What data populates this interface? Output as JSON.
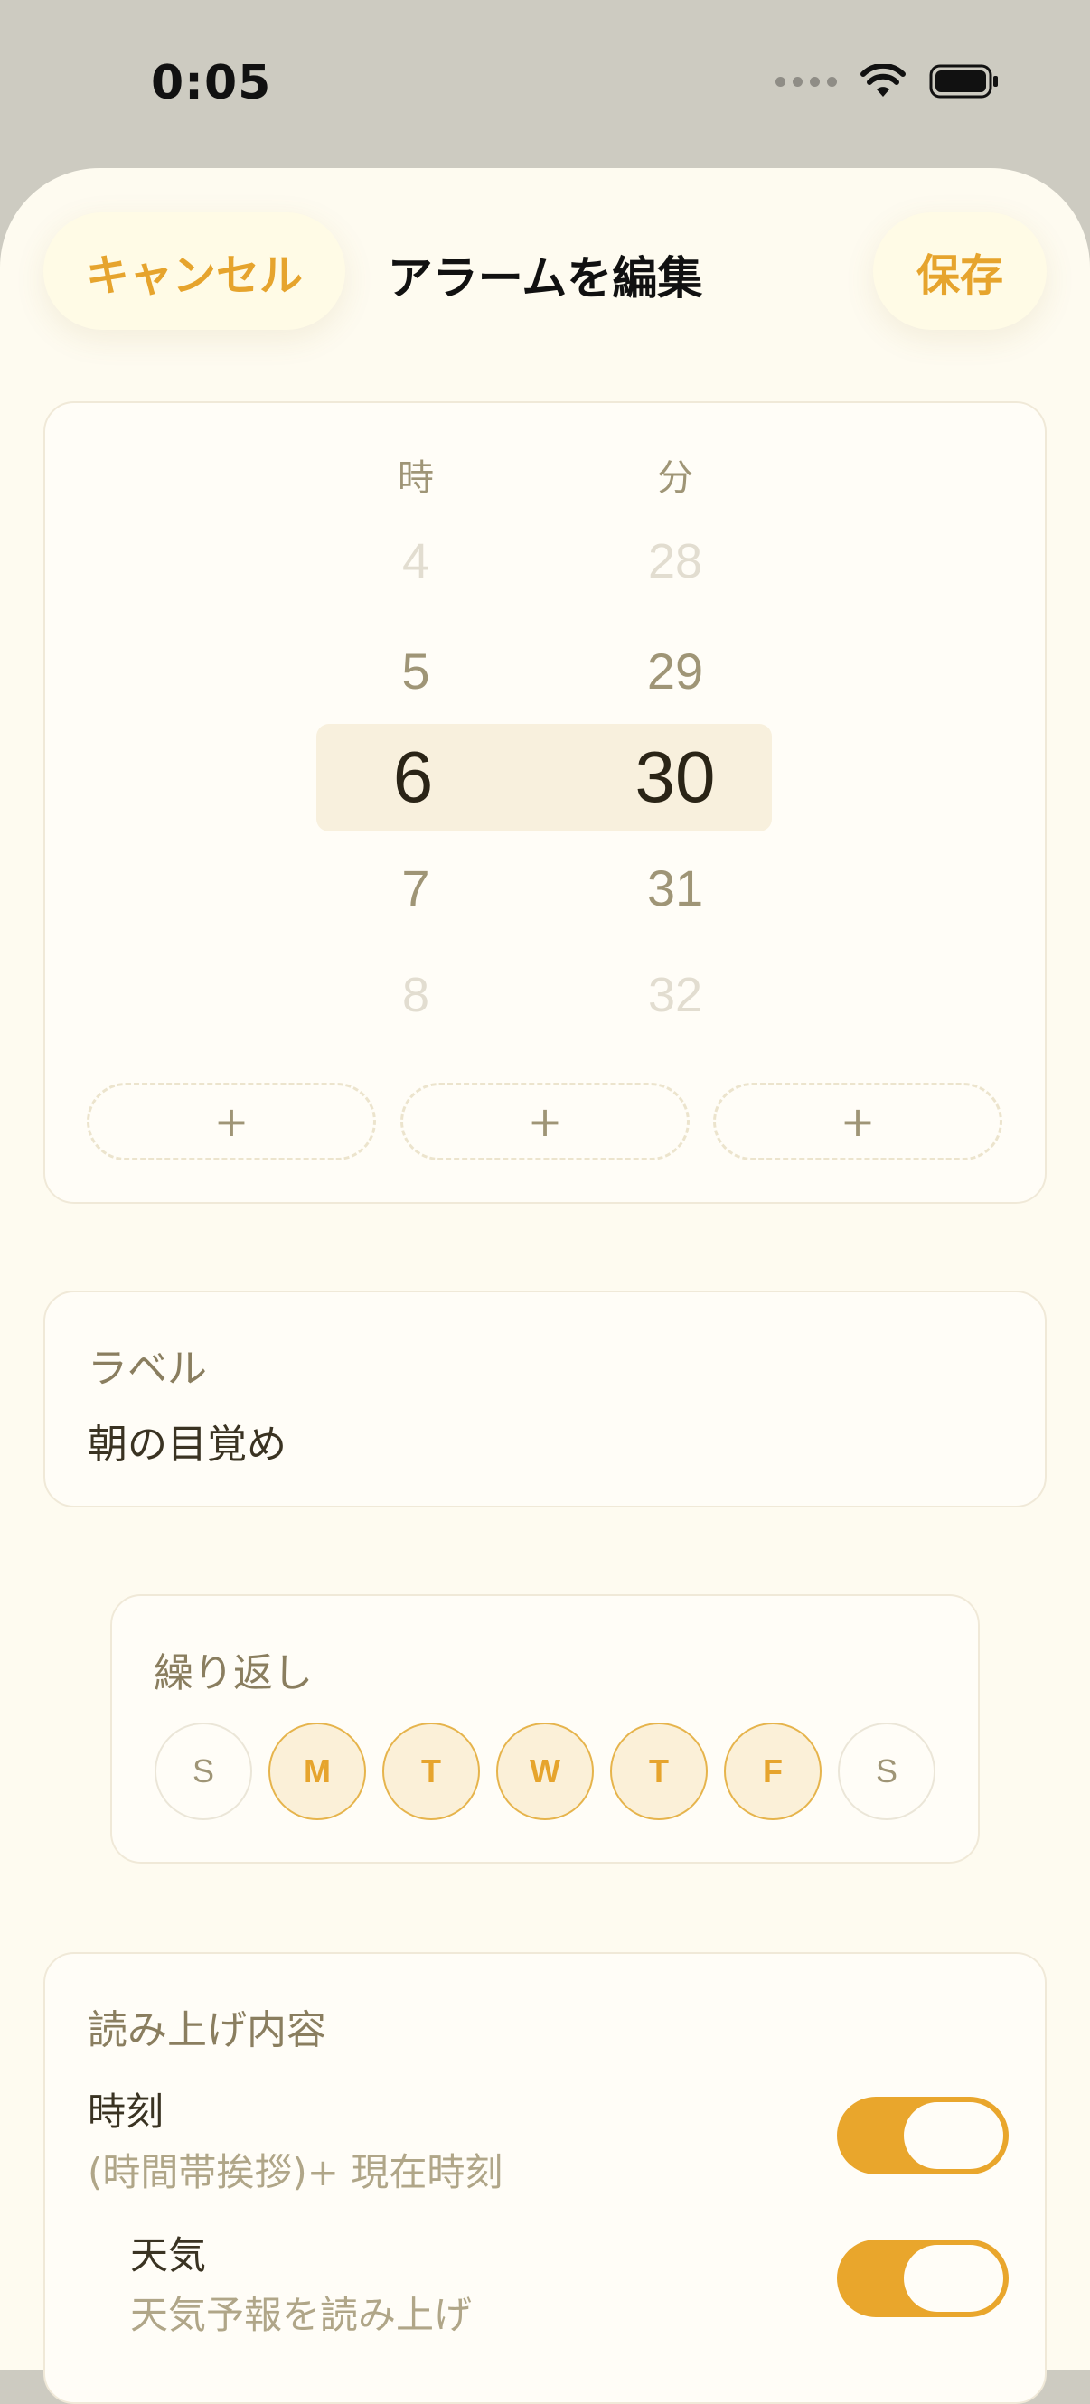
{
  "status": {
    "time": "0:05"
  },
  "nav": {
    "cancel": "キャンセル",
    "title": "アラームを編集",
    "save": "保存"
  },
  "picker": {
    "hour_label": "時",
    "minute_label": "分",
    "hours": [
      "4",
      "5",
      "6",
      "7",
      "8"
    ],
    "minutes": [
      "28",
      "29",
      "30",
      "31",
      "32"
    ],
    "add_buttons": [
      "+",
      "+",
      "+"
    ]
  },
  "label": {
    "title": "ラベル",
    "value": "朝の目覚め"
  },
  "repeat": {
    "title": "繰り返し",
    "days": [
      {
        "letter": "S",
        "active": false
      },
      {
        "letter": "M",
        "active": true
      },
      {
        "letter": "T",
        "active": true
      },
      {
        "letter": "W",
        "active": true
      },
      {
        "letter": "T",
        "active": true
      },
      {
        "letter": "F",
        "active": true
      },
      {
        "letter": "S",
        "active": false
      }
    ]
  },
  "readout": {
    "title": "読み上げ内容",
    "items": [
      {
        "title": "時刻",
        "subtitle": "(時間帯挨拶)+ 現在時刻",
        "enabled": true
      },
      {
        "title": "天気",
        "subtitle": "天気予報を読み上げ",
        "enabled": true
      }
    ]
  },
  "colors": {
    "accent": "#e9a62c",
    "background": "#fefbf0"
  }
}
